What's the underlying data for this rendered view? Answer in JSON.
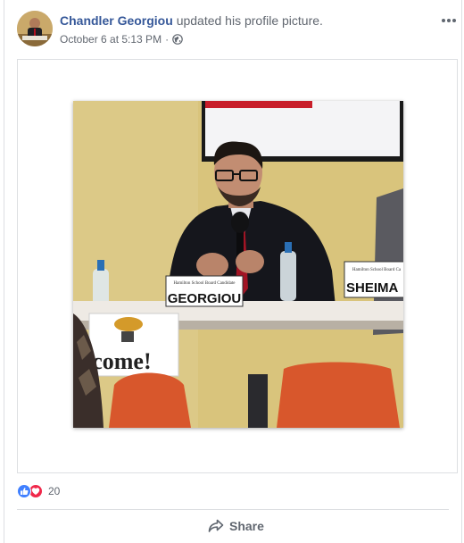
{
  "post": {
    "author": "Chandler Georgiou",
    "action_text": "updated his profile picture.",
    "timestamp": "October 6 at 5:13 PM",
    "separator": "·",
    "privacy_icon": "globe-icon",
    "more_icon": "more-options-icon"
  },
  "photo": {
    "nameplate_center": "GEORGIOU",
    "nameplate_right": "SHEIMA",
    "banner_text": "lcome!"
  },
  "reactions": {
    "types": [
      "like",
      "love"
    ],
    "count": "20"
  },
  "actions": {
    "share_label": "Share"
  },
  "colors": {
    "author_link": "#365899",
    "like_blue": "#4080ff",
    "love_red": "#f0284a",
    "secondary_text": "#616770"
  }
}
